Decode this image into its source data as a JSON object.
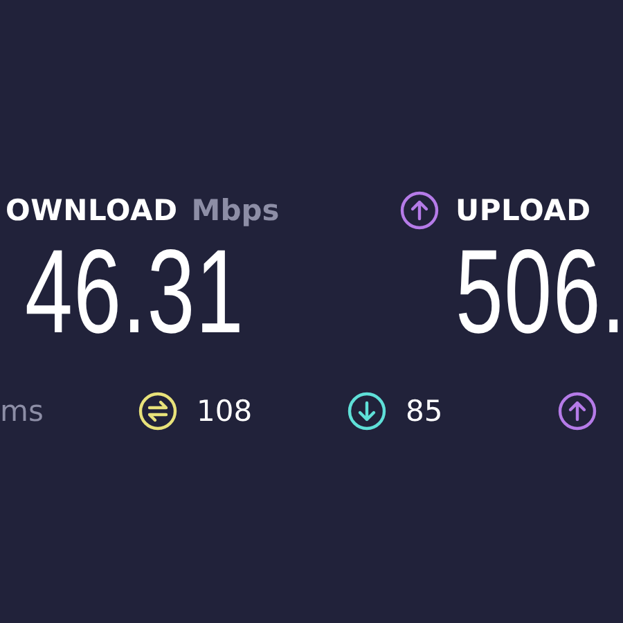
{
  "download": {
    "label": "OWNLOAD",
    "unit": "Mbps",
    "value": "46.31"
  },
  "upload": {
    "label": "UPLOAD",
    "value": "506.",
    "color": "#b57be8"
  },
  "latency": [
    {
      "kind": "unit",
      "text": "ms"
    },
    {
      "kind": "jitter",
      "text": "108",
      "color": "#e8e27a"
    },
    {
      "kind": "down",
      "text": "85",
      "color": "#5fe0d8"
    },
    {
      "kind": "up",
      "color": "#b57be8"
    }
  ]
}
